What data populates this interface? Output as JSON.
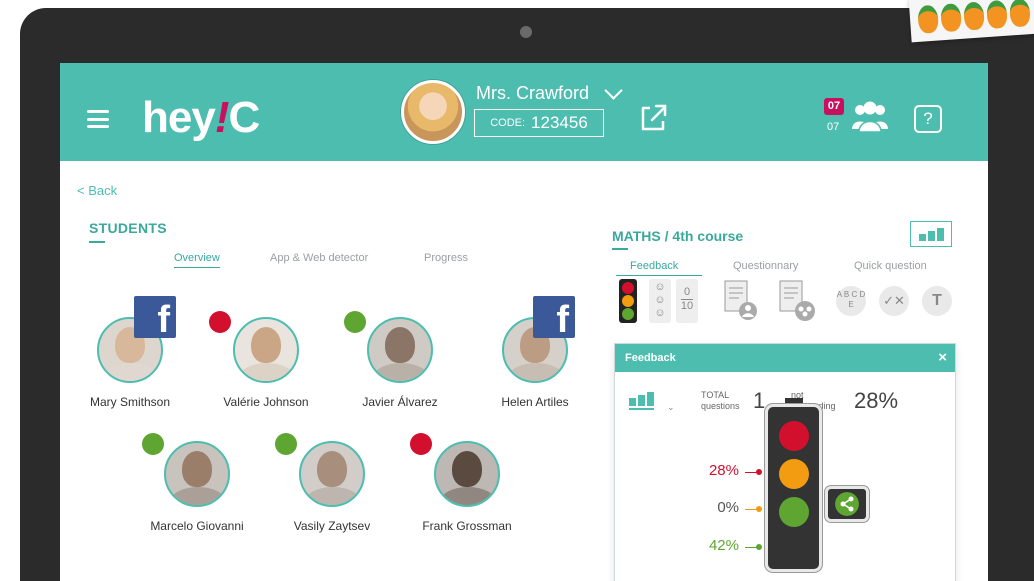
{
  "header": {
    "teacher_name": "Mrs. Crawford",
    "code_label": "CODE:",
    "code_value": "123456",
    "badge_top": "07",
    "badge_bottom": "07",
    "help_label": "?",
    "colors": {
      "accent": "#4dbdb0",
      "brand_mark": "#c8105f"
    }
  },
  "logo": {
    "prefix": "hey",
    "mark": "!",
    "suffix": "C"
  },
  "left": {
    "back": "< Back",
    "title": "STUDENTS",
    "tabs": [
      "Overview",
      "App & Web  detector",
      "Progress"
    ]
  },
  "students": [
    {
      "name": "Mary Smithson",
      "status": "facebook"
    },
    {
      "name": "Valérie Johnson",
      "status": "red"
    },
    {
      "name": "Javier Álvarez",
      "status": "green"
    },
    {
      "name": "Helen Artiles",
      "status": "facebook"
    },
    {
      "name": "Marcelo Giovanni",
      "status": "green"
    },
    {
      "name": "Vasily Zaytsev",
      "status": "green"
    },
    {
      "name": "Frank Grossman",
      "status": "red"
    }
  ],
  "right": {
    "course": "MATHS / 4th course",
    "tabs": [
      "Feedback",
      "Questionnary",
      "Quick question"
    ],
    "tools": {
      "score_top": "0",
      "score_bottom": "10",
      "abc": "A B C D E",
      "check_cross": "✓✕",
      "text_tool": "T"
    }
  },
  "feedback_panel": {
    "title": "Feedback",
    "close": "×",
    "total_label_1": "TOTAL",
    "total_label_2": "questions",
    "total_value": "1",
    "not_resp_label_1": "not",
    "not_resp_label_2": "responding",
    "not_resp_value": "28%",
    "red_pct": "28%",
    "yellow_pct": "0%",
    "green_pct": "42%",
    "colors": {
      "red": "#d2102e",
      "yellow": "#f39c12",
      "green": "#5fa532"
    }
  }
}
